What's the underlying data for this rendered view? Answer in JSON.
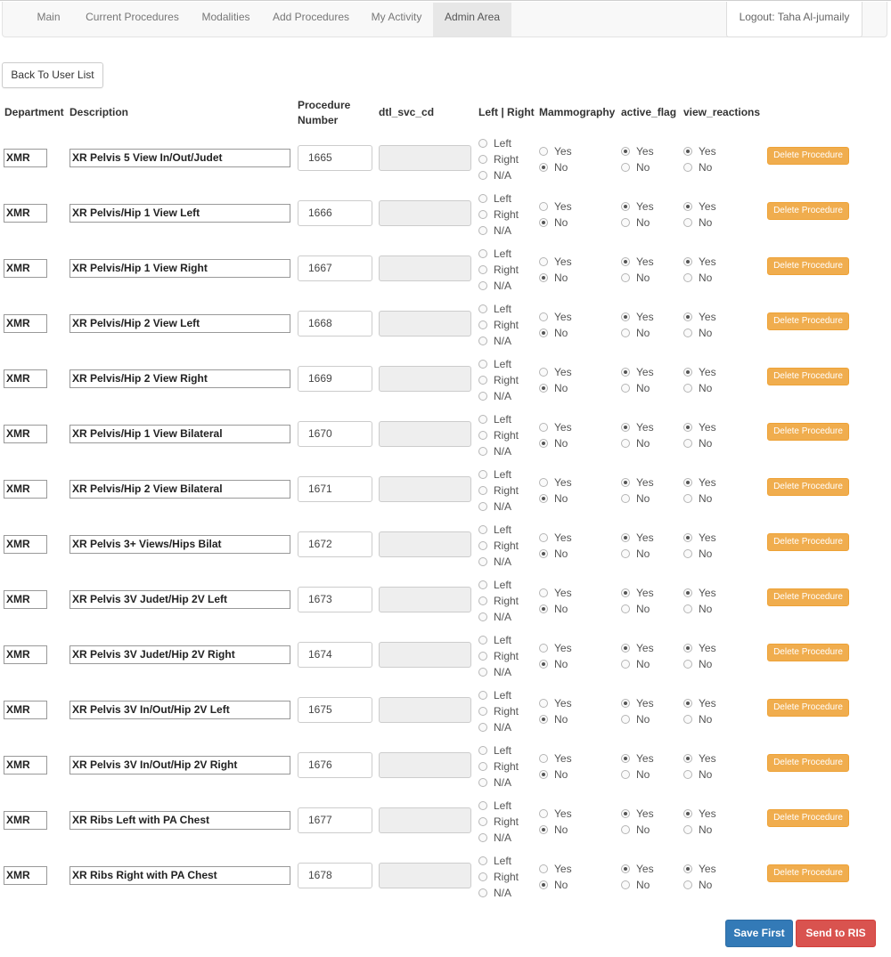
{
  "nav": {
    "items": [
      {
        "label": "Main",
        "active": false
      },
      {
        "label": "Current Procedures",
        "active": false
      },
      {
        "label": "Modalities",
        "active": false
      },
      {
        "label": "Add Procedures",
        "active": false
      },
      {
        "label": "My Activity",
        "active": false
      },
      {
        "label": "Admin Area",
        "active": true
      }
    ],
    "logout": "Logout: Taha Al-jumaily"
  },
  "back_button": "Back To User List",
  "headers": {
    "department": "Department",
    "description": "Description",
    "procedure_number": "Procedure Number",
    "dtl_svc_cd": "dtl_svc_cd",
    "left_right": "Left | Right",
    "mammography": "Mammography",
    "active_flag": "active_flag",
    "view_reactions": "view_reactions"
  },
  "labels": {
    "left": "Left",
    "right": "Right",
    "na": "N/A",
    "yes": "Yes",
    "no": "No",
    "delete": "Delete Procedure"
  },
  "rows": [
    {
      "department": "XMR",
      "description": "XR Pelvis 5 View In/Out/Judet",
      "number": "1665",
      "dtl_svc_cd": "",
      "side": "",
      "mammography": "No",
      "active_flag": "Yes",
      "view_reactions": "Yes"
    },
    {
      "department": "XMR",
      "description": "XR Pelvis/Hip 1 View Left",
      "number": "1666",
      "dtl_svc_cd": "",
      "side": "",
      "mammography": "No",
      "active_flag": "Yes",
      "view_reactions": "Yes"
    },
    {
      "department": "XMR",
      "description": "XR Pelvis/Hip 1 View Right",
      "number": "1667",
      "dtl_svc_cd": "",
      "side": "",
      "mammography": "No",
      "active_flag": "Yes",
      "view_reactions": "Yes"
    },
    {
      "department": "XMR",
      "description": "XR Pelvis/Hip 2 View Left",
      "number": "1668",
      "dtl_svc_cd": "",
      "side": "",
      "mammography": "No",
      "active_flag": "Yes",
      "view_reactions": "Yes"
    },
    {
      "department": "XMR",
      "description": "XR Pelvis/Hip 2 View Right",
      "number": "1669",
      "dtl_svc_cd": "",
      "side": "",
      "mammography": "No",
      "active_flag": "Yes",
      "view_reactions": "Yes"
    },
    {
      "department": "XMR",
      "description": "XR Pelvis/Hip 1 View Bilateral",
      "number": "1670",
      "dtl_svc_cd": "",
      "side": "",
      "mammography": "No",
      "active_flag": "Yes",
      "view_reactions": "Yes"
    },
    {
      "department": "XMR",
      "description": "XR Pelvis/Hip 2 View Bilateral",
      "number": "1671",
      "dtl_svc_cd": "",
      "side": "",
      "mammography": "No",
      "active_flag": "Yes",
      "view_reactions": "Yes"
    },
    {
      "department": "XMR",
      "description": "XR Pelvis 3+ Views/Hips Bilat",
      "number": "1672",
      "dtl_svc_cd": "",
      "side": "",
      "mammography": "No",
      "active_flag": "Yes",
      "view_reactions": "Yes"
    },
    {
      "department": "XMR",
      "description": "XR Pelvis 3V Judet/Hip 2V Left",
      "number": "1673",
      "dtl_svc_cd": "",
      "side": "",
      "mammography": "No",
      "active_flag": "Yes",
      "view_reactions": "Yes"
    },
    {
      "department": "XMR",
      "description": "XR Pelvis 3V Judet/Hip 2V Right",
      "number": "1674",
      "dtl_svc_cd": "",
      "side": "",
      "mammography": "No",
      "active_flag": "Yes",
      "view_reactions": "Yes"
    },
    {
      "department": "XMR",
      "description": "XR Pelvis 3V In/Out/Hip 2V Left",
      "number": "1675",
      "dtl_svc_cd": "",
      "side": "",
      "mammography": "No",
      "active_flag": "Yes",
      "view_reactions": "Yes"
    },
    {
      "department": "XMR",
      "description": "XR Pelvis 3V In/Out/Hip 2V Right",
      "number": "1676",
      "dtl_svc_cd": "",
      "side": "",
      "mammography": "No",
      "active_flag": "Yes",
      "view_reactions": "Yes"
    },
    {
      "department": "XMR",
      "description": "XR Ribs Left with PA Chest",
      "number": "1677",
      "dtl_svc_cd": "",
      "side": "",
      "mammography": "No",
      "active_flag": "Yes",
      "view_reactions": "Yes"
    },
    {
      "department": "XMR",
      "description": "XR Ribs Right with PA Chest",
      "number": "1678",
      "dtl_svc_cd": "",
      "side": "",
      "mammography": "No",
      "active_flag": "Yes",
      "view_reactions": "Yes"
    }
  ],
  "footer": {
    "save_label": "Save First",
    "send_label": "Send to RIS"
  }
}
